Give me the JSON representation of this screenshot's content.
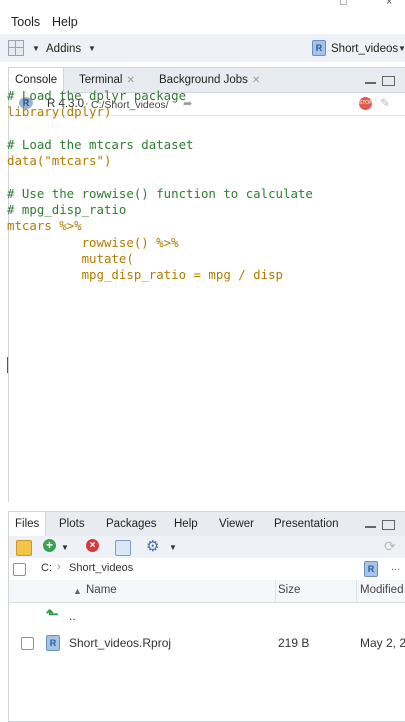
{
  "menubar": {
    "tools": "Tools",
    "help": "Help"
  },
  "toolbar": {
    "addins": "Addins",
    "project": "Short_videos"
  },
  "console": {
    "tabs": [
      {
        "label": "Console"
      },
      {
        "label": "Terminal"
      },
      {
        "label": "Background Jobs"
      }
    ],
    "r_version": "R 4.3.0",
    "path": "C:/Short_videos/",
    "lines": [
      {
        "text": "# Load the dplyr package",
        "kind": "comment"
      },
      {
        "text": "library(dplyr)",
        "kind": "code"
      },
      {
        "text": "",
        "kind": "code"
      },
      {
        "text": "# Load the mtcars dataset",
        "kind": "comment"
      },
      {
        "text": "data(\"mtcars\")",
        "kind": "code"
      },
      {
        "text": "",
        "kind": "code"
      },
      {
        "text": "# Use the rowwise() function to calculate",
        "kind": "comment"
      },
      {
        "text": "# mpg_disp_ratio",
        "kind": "comment"
      },
      {
        "text": "mtcars %>%",
        "kind": "code"
      },
      {
        "text": "          rowwise() %>%",
        "kind": "code"
      },
      {
        "text": "          mutate(",
        "kind": "code"
      },
      {
        "text": "          mpg_disp_ratio = mpg / disp",
        "kind": "code"
      }
    ]
  },
  "files": {
    "tabs": [
      "Files",
      "Plots",
      "Packages",
      "Help",
      "Viewer",
      "Presentation"
    ],
    "breadcrumb": {
      "root": "C:",
      "folder": "Short_videos"
    },
    "more": "...",
    "columns": {
      "name": "Name",
      "size": "Size",
      "modified": "Modified"
    },
    "rows": [
      {
        "name": "..",
        "size": "",
        "modified": ""
      },
      {
        "name": "Short_videos.Rproj",
        "size": "219 B",
        "modified": "May 2, 2"
      }
    ]
  }
}
